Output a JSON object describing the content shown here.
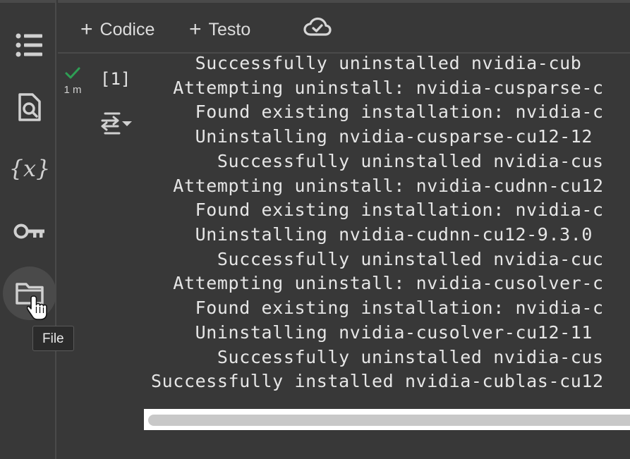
{
  "sidebar": {
    "items": [
      {
        "name": "table-of-contents",
        "icon": "list-icon"
      },
      {
        "name": "find",
        "icon": "document-search-icon"
      },
      {
        "name": "variables",
        "icon": "variables-icon",
        "glyph": "{x}"
      },
      {
        "name": "secrets",
        "icon": "key-icon"
      },
      {
        "name": "files",
        "icon": "folder-icon",
        "active": true
      }
    ],
    "tooltip": "File"
  },
  "toolbar": {
    "add_code_label": "Codice",
    "add_text_label": "Testo",
    "plus_glyph": "+",
    "cloud_icon": "cloud-check-icon"
  },
  "cell": {
    "status_icon": "check-icon",
    "status_color": "#2e9e54",
    "exec_time": "1 m",
    "exec_count": "[1]",
    "output_toggle_icon": "output-actions-icon"
  },
  "output": {
    "lines": [
      "    Successfully uninstalled nvidia-cub",
      "  Attempting uninstall: nvidia-cusparse-c",
      "    Found existing installation: nvidia-c",
      "    Uninstalling nvidia-cusparse-cu12-12",
      "      Successfully uninstalled nvidia-cus",
      "  Attempting uninstall: nvidia-cudnn-cu12",
      "    Found existing installation: nvidia-c",
      "    Uninstalling nvidia-cudnn-cu12-9.3.0",
      "      Successfully uninstalled nvidia-cuc",
      "  Attempting uninstall: nvidia-cusolver-c",
      "    Found existing installation: nvidia-c",
      "    Uninstalling nvidia-cusolver-cu12-11",
      "      Successfully uninstalled nvidia-cus",
      "Successfully installed nvidia-cublas-cu12"
    ]
  },
  "colors": {
    "background": "#383838",
    "text": "#e6e6e6",
    "divider": "#4a4a4a"
  }
}
